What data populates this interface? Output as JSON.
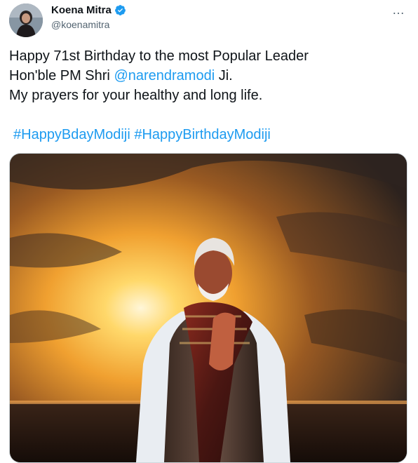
{
  "user": {
    "display_name": "Koena Mitra",
    "handle": "@koenamitra",
    "verified_icon": "verified-badge-icon"
  },
  "menu_icon": "…",
  "tweet": {
    "line1": "Happy 71st Birthday to the most Popular Leader",
    "line2_prefix": "Hon'ble PM Shri ",
    "mention": "@narendramodi",
    "line2_suffix": " Ji.",
    "line3": "My prayers for your healthy and long life.",
    "hashtag1": "#HappyBdayModiji",
    "hashtag2": "#HappyBirthdayModiji"
  },
  "colors": {
    "link": "#1d9bf0",
    "text": "#0f1419",
    "secondary": "#536471"
  }
}
